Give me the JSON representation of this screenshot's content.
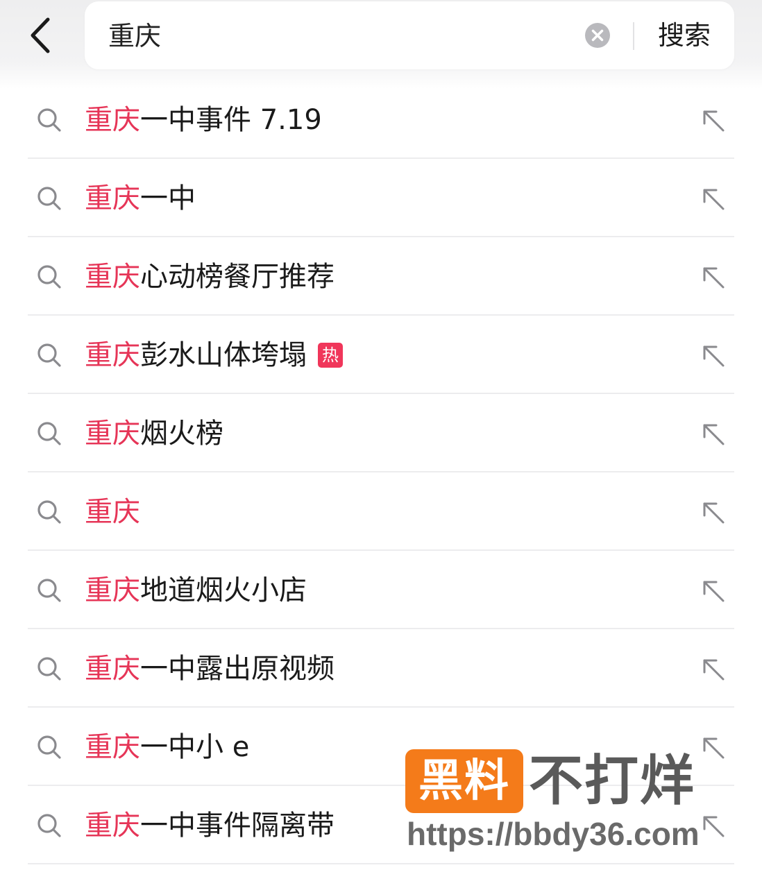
{
  "search": {
    "query": "重庆",
    "submit_label": "搜索"
  },
  "icons": {
    "back": "chevron-left-icon",
    "clear": "clear-circle-icon",
    "suggestion": "search-icon",
    "fill": "arrow-up-left-icon"
  },
  "colors": {
    "highlight": "#e63557",
    "hot_badge": "#f0365a",
    "watermark_logo": "#f47b1a"
  },
  "suggestions": [
    {
      "highlight": "重庆",
      "rest": "一中事件 7.19",
      "badge": ""
    },
    {
      "highlight": "重庆",
      "rest": "一中",
      "badge": ""
    },
    {
      "highlight": "重庆",
      "rest": "心动榜餐厅推荐",
      "badge": ""
    },
    {
      "highlight": "重庆",
      "rest": "彭水山体垮塌",
      "badge": "热"
    },
    {
      "highlight": "重庆",
      "rest": "烟火榜",
      "badge": ""
    },
    {
      "highlight": "重庆",
      "rest": "",
      "badge": ""
    },
    {
      "highlight": "重庆",
      "rest": "地道烟火小店",
      "badge": ""
    },
    {
      "highlight": "重庆",
      "rest": "一中露出原视频",
      "badge": ""
    },
    {
      "highlight": "重庆",
      "rest": "一中小 e",
      "badge": ""
    },
    {
      "highlight": "重庆",
      "rest": "一中事件隔离带",
      "badge": ""
    }
  ],
  "watermark": {
    "logo_text": "黑料",
    "name": "不打烊",
    "url": "https://bbdy36.com"
  }
}
